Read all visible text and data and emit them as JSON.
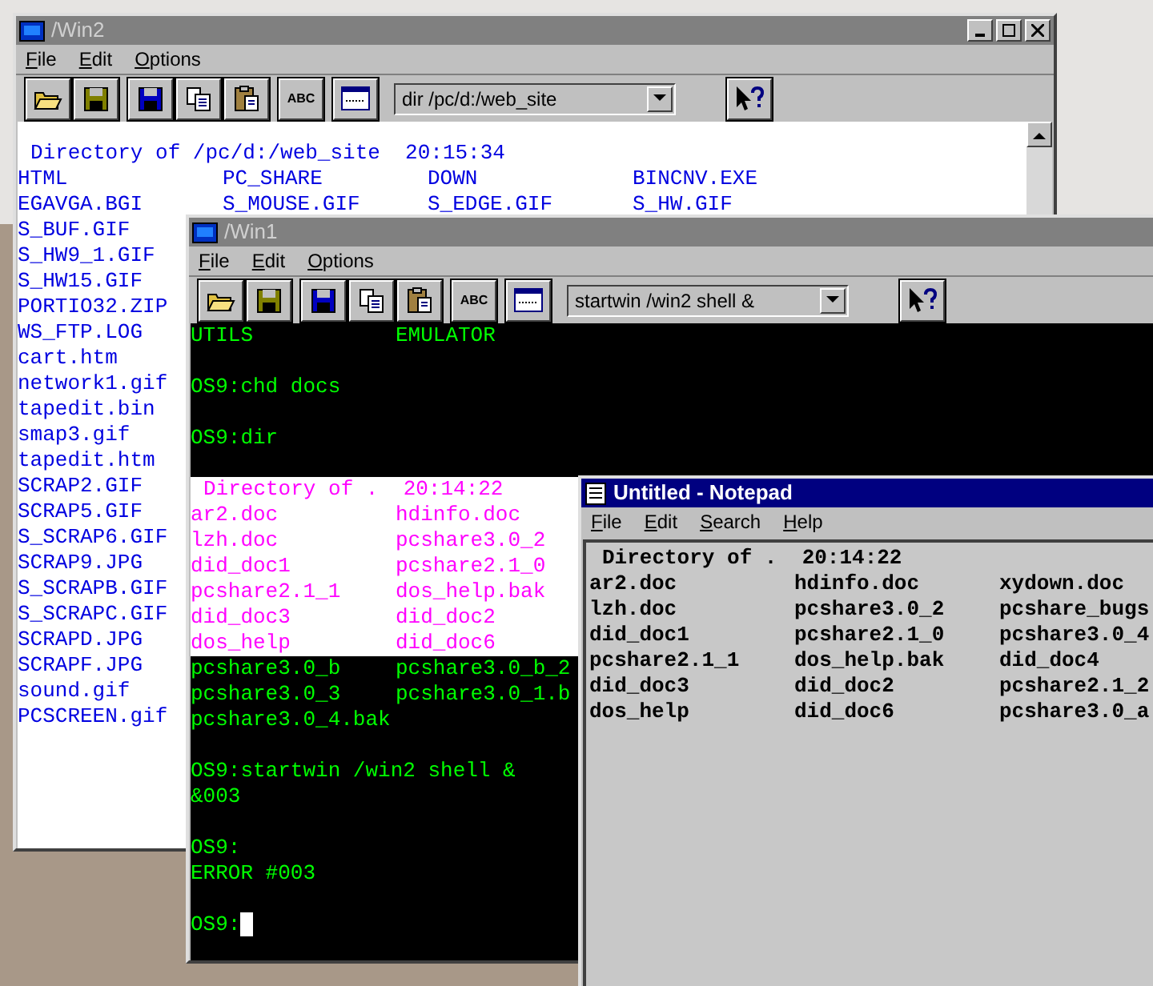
{
  "windows": [
    {
      "kind": "listing",
      "title": "/Win2",
      "active": false,
      "menu": [
        "File",
        "Edit",
        "Options"
      ],
      "toolbar": {
        "abc_label": "ABC",
        "command": "dir /pc/d:/web_site"
      },
      "lines": [
        {
          "kind": "header",
          "columns": [
            "Directory of /pc/d:/web_site  20:15:34"
          ]
        },
        {
          "kind": "row",
          "columns": [
            "HTML",
            "PC_SHARE",
            "DOWN",
            "BINCNV.EXE"
          ]
        },
        {
          "kind": "row",
          "columns": [
            "EGAVGA.BGI",
            "S_MOUSE.GIF",
            "S_EDGE.GIF",
            "S_HW.GIF"
          ]
        },
        {
          "kind": "row",
          "columns": [
            "S_BUF.GIF"
          ]
        },
        {
          "kind": "row",
          "columns": [
            "S_HW9_1.GIF"
          ]
        },
        {
          "kind": "row",
          "columns": [
            "S_HW15.GIF"
          ]
        },
        {
          "kind": "row",
          "columns": [
            "PORTIO32.ZIP"
          ]
        },
        {
          "kind": "row",
          "columns": [
            "WS_FTP.LOG"
          ]
        },
        {
          "kind": "row",
          "columns": [
            "cart.htm"
          ]
        },
        {
          "kind": "row",
          "columns": [
            "network1.gif"
          ]
        },
        {
          "kind": "row",
          "columns": [
            "tapedit.bin"
          ]
        },
        {
          "kind": "row",
          "columns": [
            "smap3.gif"
          ]
        },
        {
          "kind": "row",
          "columns": [
            "tapedit.htm"
          ]
        },
        {
          "kind": "row",
          "columns": [
            "SCRAP2.GIF"
          ]
        },
        {
          "kind": "row",
          "columns": [
            "SCRAP5.GIF"
          ]
        },
        {
          "kind": "row",
          "columns": [
            "S_SCRAP6.GIF"
          ]
        },
        {
          "kind": "row",
          "columns": [
            "SCRAP9.JPG"
          ]
        },
        {
          "kind": "row",
          "columns": [
            "S_SCRAPB.GIF"
          ]
        },
        {
          "kind": "row",
          "columns": [
            "S_SCRAPC.GIF"
          ]
        },
        {
          "kind": "row",
          "columns": [
            "SCRAPD.JPG"
          ]
        },
        {
          "kind": "row",
          "columns": [
            "SCRAPF.JPG"
          ]
        },
        {
          "kind": "row",
          "columns": [
            "sound.gif"
          ]
        },
        {
          "kind": "row",
          "columns": [
            "PCSCREEN.gif"
          ]
        }
      ]
    },
    {
      "kind": "console",
      "title": "/Win1",
      "active": false,
      "menu": [
        "File",
        "Edit",
        "Options"
      ],
      "toolbar": {
        "abc_label": "ABC",
        "command": "startwin /win2 shell &"
      },
      "lines": [
        {
          "kind": "row",
          "highlight": false,
          "columns": [
            "UTILS",
            "EMULATOR"
          ]
        },
        {
          "kind": "blank",
          "highlight": false
        },
        {
          "kind": "row",
          "highlight": false,
          "columns": [
            "OS9:chd docs"
          ]
        },
        {
          "kind": "blank",
          "highlight": false
        },
        {
          "kind": "row",
          "highlight": false,
          "columns": [
            "OS9:dir"
          ]
        },
        {
          "kind": "blank",
          "highlight": false
        },
        {
          "kind": "header",
          "highlight": true,
          "columns": [
            "Directory of .  20:14:22"
          ]
        },
        {
          "kind": "row",
          "highlight": true,
          "columns": [
            "ar2.doc",
            "hdinfo.doc"
          ]
        },
        {
          "kind": "row",
          "highlight": true,
          "columns": [
            "lzh.doc",
            "pcshare3.0_2"
          ]
        },
        {
          "kind": "row",
          "highlight": true,
          "columns": [
            "did_doc1",
            "pcshare2.1_0"
          ]
        },
        {
          "kind": "row",
          "highlight": true,
          "columns": [
            "pcshare2.1_1",
            "dos_help.bak"
          ]
        },
        {
          "kind": "row",
          "highlight": true,
          "columns": [
            "did_doc3",
            "did_doc2"
          ]
        },
        {
          "kind": "row",
          "highlight": true,
          "columns": [
            "dos_help",
            "did_doc6"
          ]
        },
        {
          "kind": "row",
          "highlight": false,
          "columns": [
            "pcshare3.0_b",
            "pcshare3.0_b_2"
          ]
        },
        {
          "kind": "row",
          "highlight": false,
          "columns": [
            "pcshare3.0_3",
            "pcshare3.0_1.b"
          ]
        },
        {
          "kind": "row",
          "highlight": false,
          "columns": [
            "pcshare3.0_4.bak"
          ]
        },
        {
          "kind": "blank",
          "highlight": false
        },
        {
          "kind": "row",
          "highlight": false,
          "columns": [
            "OS9:startwin /win2 shell &"
          ]
        },
        {
          "kind": "row",
          "highlight": false,
          "columns": [
            "&003"
          ]
        },
        {
          "kind": "blank",
          "highlight": false
        },
        {
          "kind": "row",
          "highlight": false,
          "columns": [
            "OS9:"
          ]
        },
        {
          "kind": "row",
          "highlight": false,
          "columns": [
            "ERROR #003"
          ]
        },
        {
          "kind": "blank",
          "highlight": false
        },
        {
          "kind": "row",
          "highlight": false,
          "cursor": true,
          "columns": [
            "OS9:"
          ]
        }
      ]
    },
    {
      "kind": "notepad",
      "title": "Untitled - Notepad",
      "active": true,
      "menu": [
        "File",
        "Edit",
        "Search",
        "Help"
      ],
      "lines": [
        {
          "kind": "header",
          "columns": [
            "Directory of .  20:14:22"
          ]
        },
        {
          "kind": "row",
          "columns": [
            "ar2.doc",
            "hdinfo.doc",
            "xydown.doc"
          ]
        },
        {
          "kind": "row",
          "columns": [
            "lzh.doc",
            "pcshare3.0_2",
            "pcshare_bugs"
          ]
        },
        {
          "kind": "row",
          "columns": [
            "did_doc1",
            "pcshare2.1_0",
            "pcshare3.0_4"
          ]
        },
        {
          "kind": "row",
          "columns": [
            "pcshare2.1_1",
            "dos_help.bak",
            "did_doc4"
          ]
        },
        {
          "kind": "row",
          "columns": [
            "did_doc3",
            "did_doc2",
            "pcshare2.1_2"
          ]
        },
        {
          "kind": "row",
          "columns": [
            "dos_help",
            "did_doc6",
            "pcshare3.0_a"
          ]
        }
      ]
    }
  ]
}
